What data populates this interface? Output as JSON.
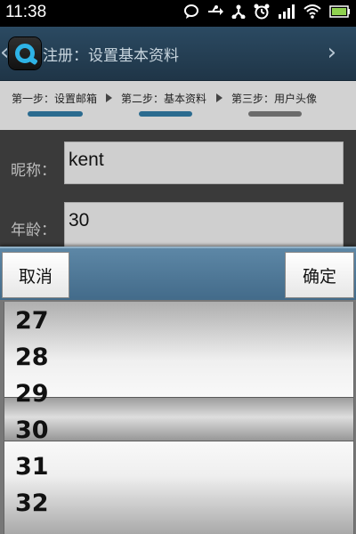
{
  "status_bar": {
    "time": "11:38",
    "icons": [
      "chat-bubble-icon",
      "usb-icon",
      "share-icon",
      "alarm-clock-icon",
      "signal-icon",
      "wifi-icon",
      "battery-icon"
    ]
  },
  "title_bar": {
    "title": "注册：设置基本资料"
  },
  "steps": [
    {
      "label": "第一步：设置邮箱",
      "state": "done",
      "color": "#2b6b8f"
    },
    {
      "label": "第二步：基本资料",
      "state": "current",
      "color": "#2b6b8f"
    },
    {
      "label": "第三步：用户头像",
      "state": "pending",
      "color": "#6b6b6b"
    }
  ],
  "form": {
    "nickname_label": "昵称：",
    "nickname_value": "kent",
    "age_label": "年龄：",
    "age_value": "30"
  },
  "picker": {
    "cancel_label": "取消",
    "confirm_label": "确定",
    "items": [
      "27",
      "28",
      "29",
      "30",
      "31",
      "32"
    ],
    "selected": "30"
  },
  "colors": {
    "title_bar": "#24405a",
    "step_active": "#2b6b8f",
    "picker_bar": "#4d7696"
  }
}
